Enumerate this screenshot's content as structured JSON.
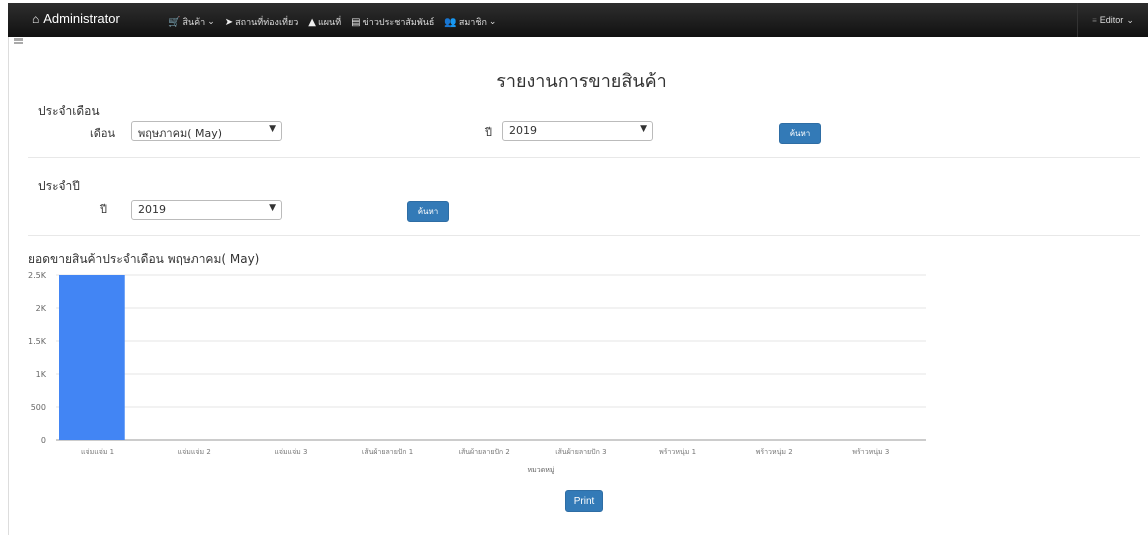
{
  "navbar": {
    "brand": "Administrator",
    "items": [
      {
        "icon": "cart-icon",
        "glyph": "🛒",
        "label": "สินค้า",
        "dropdown": true
      },
      {
        "icon": "paper-plane-icon",
        "glyph": "➤",
        "label": "สถานที่ท่องเที่ยว",
        "dropdown": false
      },
      {
        "icon": "map-icon",
        "glyph": "▲",
        "label": "แผนที่",
        "dropdown": false
      },
      {
        "icon": "newspaper-icon",
        "glyph": "▤",
        "label": "ข่าวประชาสัมพันธ์",
        "dropdown": false
      },
      {
        "icon": "users-icon",
        "glyph": "👥",
        "label": "สมาชิก",
        "dropdown": true
      }
    ],
    "user": "Editor"
  },
  "page_title": "รายงานการขายสินค้า",
  "monthly": {
    "section_label": "ประจำเดือน",
    "month_label": "เดือน",
    "month_value": "พฤษภาคม( May)",
    "year_label": "ปี",
    "year_value": "2019",
    "search_label": "ค้นหา"
  },
  "yearly": {
    "section_label": "ประจำปี",
    "year_label": "ปี",
    "year_value": "2019",
    "search_label": "ค้นหา"
  },
  "chart_title": "ยอดขายสินค้าประจำเดือน พฤษภาคม( May)",
  "chart_data": {
    "type": "bar",
    "categories": [
      "แจ่มแจ่ม 1",
      "แจ่มแจ่ม 2",
      "แจ่มแจ่ม 3",
      "เส้นผ้ายลายปัก 1",
      "เส้นผ้ายลายปัก 2",
      "เส้นผ้ายลายปัก 3",
      "พร้าวหนุ่ม 1",
      "พร้าวหนุ่ม 2",
      "พร้าวหนุ่ม 3"
    ],
    "values": [
      2500,
      0,
      0,
      0,
      0,
      0,
      0,
      0,
      0
    ],
    "ylim": [
      0,
      2500
    ],
    "yticks": [
      0,
      500,
      1000,
      1500,
      2000,
      2500
    ],
    "ytick_labels": [
      "0",
      "500",
      "1K",
      "1.5K",
      "2K",
      "2.5K"
    ],
    "xlabel": "หมวดหมู่",
    "ylabel": "",
    "bar_color": "#4285f4",
    "grid": true
  },
  "print_label": "Print"
}
